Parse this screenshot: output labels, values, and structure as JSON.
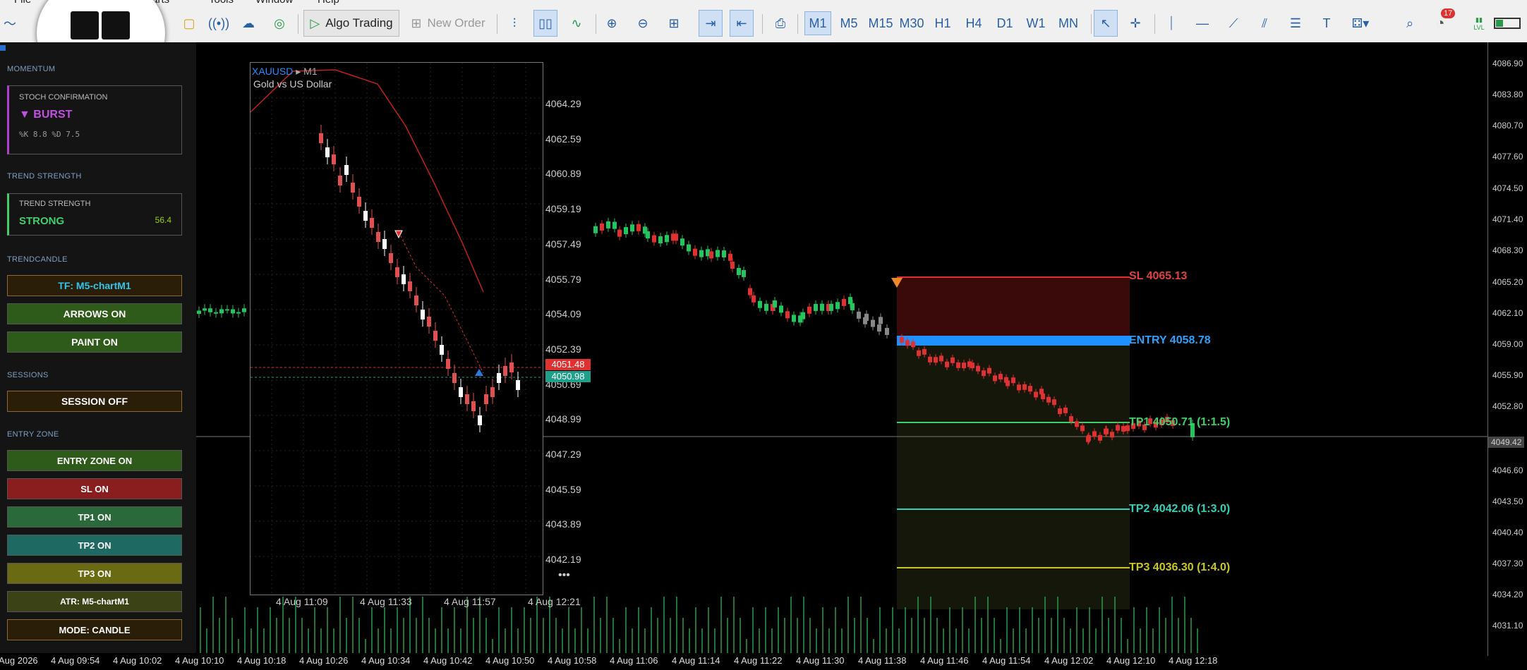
{
  "menu": [
    "File",
    "Charts",
    "Tools",
    "Window",
    "Help"
  ],
  "toolbar": {
    "algo_trading": "Algo Trading",
    "new_order": "New Order",
    "timeframes": [
      "M1",
      "M5",
      "M15",
      "M30",
      "H1",
      "H4",
      "D1",
      "W1",
      "MN"
    ],
    "active_timeframe": "M1",
    "notification_count": "17",
    "lvl": "LVL"
  },
  "panel": {
    "momentum_header": "MOMENTUM",
    "stoch_title": "STOCH CONFIRMATION",
    "stoch_state": "▼ BURST",
    "stoch_values": "%K   8.8   %D   7.5",
    "trend_header": "TREND STRENGTH",
    "trend_title": "TREND STRENGTH",
    "trend_state": "STRONG",
    "trend_value": "56.4",
    "trendcandle_header": "TRENDCANDLE",
    "tf_button": "TF: M5-chartM1",
    "arrows_button": "ARROWS ON",
    "paint_button": "PAINT ON",
    "sessions_header": "SESSIONS",
    "session_button": "SESSION OFF",
    "entryzone_header": "ENTRY ZONE",
    "entry_zone_button": "ENTRY ZONE ON",
    "sl_button": "SL  ON",
    "tp1_button": "TP1  ON",
    "tp2_button": "TP2  ON",
    "tp3_button": "TP3  ON",
    "atr_button": "ATR: M5-chartM1",
    "mode_button": "MODE: CANDLE"
  },
  "subchart": {
    "symbol": "XAUUSD",
    "timeframe": "M1",
    "description": "Gold vs US Dollar",
    "price_labels": [
      "4064.29",
      "4062.59",
      "4060.89",
      "4059.19",
      "4057.49",
      "4055.79",
      "4054.09",
      "4052.39",
      "4050.69",
      "4048.99",
      "4047.29",
      "4045.59",
      "4043.89",
      "4042.19"
    ],
    "bid_tag": "4051.48",
    "ask_tag": "4050.98",
    "time_labels": [
      "4 Aug 11:09",
      "4 Aug 11:33",
      "4 Aug 11:57",
      "4 Aug 12:21"
    ],
    "more": "•••"
  },
  "zones": {
    "sl": "SL  4065.13",
    "entry": "ENTRY 4058.78",
    "tp1": "TP1  4050.71  (1:1.5)",
    "tp2": "TP2  4042.06  (1:3.0)",
    "tp3": "TP3  4036.30  (1:4.0)"
  },
  "price_axis": [
    "4086.90",
    "4083.80",
    "4080.70",
    "4077.60",
    "4074.50",
    "4071.40",
    "4068.30",
    "4065.20",
    "4062.10",
    "4059.00",
    "4055.90",
    "4052.80",
    "4049.42",
    "4046.60",
    "4043.50",
    "4040.40",
    "4037.30",
    "4034.20",
    "4031.10"
  ],
  "current_price_tag": "4049.42",
  "time_axis": [
    "Aug 2026",
    "4 Aug 09:54",
    "4 Aug 10:02",
    "4 Aug 10:10",
    "4 Aug 10:18",
    "4 Aug 10:26",
    "4 Aug 10:34",
    "4 Aug 10:42",
    "4 Aug 10:50",
    "4 Aug 10:58",
    "4 Aug 11:06",
    "4 Aug 11:14",
    "4 Aug 11:22",
    "4 Aug 11:30",
    "4 Aug 11:38",
    "4 Aug 11:46",
    "4 Aug 11:54",
    "4 Aug 12:02",
    "4 Aug 12:10",
    "4 Aug 12:18"
  ],
  "colors": {
    "bull": "#22c55e",
    "bear": "#e03030",
    "sl_zone": "#3a0a0a",
    "entry": "#1e90ff",
    "tp1": "#3ecf6a",
    "tp2": "#2ed3b7",
    "tp3": "#c8c81e"
  }
}
